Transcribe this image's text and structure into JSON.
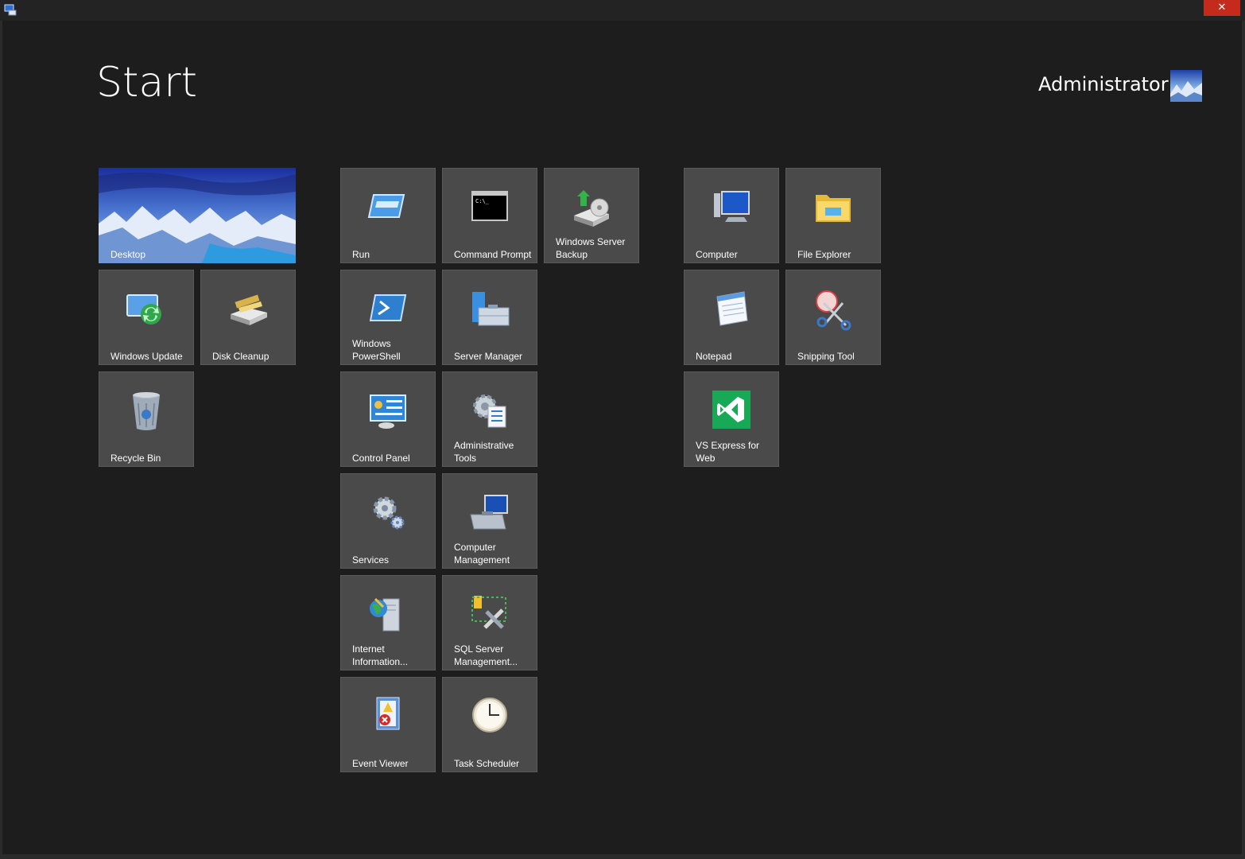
{
  "window": {
    "close_glyph": "✕"
  },
  "header": {
    "title": "Start",
    "user_name": "Administrator"
  },
  "groups": [
    {
      "tiles": [
        {
          "label": "Desktop",
          "icon": "desktop-wallpaper"
        },
        {
          "label": "Windows Update",
          "icon": "windows-update-icon"
        },
        {
          "label": "Disk Cleanup",
          "icon": "disk-cleanup-icon"
        },
        {
          "label": "Recycle Bin",
          "icon": "recycle-bin-icon"
        }
      ]
    },
    {
      "tiles": [
        {
          "label": "Run",
          "icon": "run-icon"
        },
        {
          "label": "Command Prompt",
          "icon": "command-prompt-icon"
        },
        {
          "label": "Windows Server Backup",
          "icon": "server-backup-icon"
        },
        {
          "label": "Windows PowerShell",
          "icon": "powershell-icon"
        },
        {
          "label": "Server Manager",
          "icon": "server-manager-icon"
        },
        {
          "label": "Control Panel",
          "icon": "control-panel-icon"
        },
        {
          "label": "Administrative Tools",
          "icon": "administrative-tools-icon"
        },
        {
          "label": "Services",
          "icon": "services-gear-icon"
        },
        {
          "label": "Computer Management",
          "icon": "computer-management-icon"
        },
        {
          "label": "Internet Information...",
          "icon": "iis-icon"
        },
        {
          "label": "SQL Server Management...",
          "icon": "sql-server-icon"
        },
        {
          "label": "Event Viewer",
          "icon": "event-viewer-icon"
        },
        {
          "label": "Task Scheduler",
          "icon": "task-scheduler-clock-icon"
        }
      ]
    },
    {
      "tiles": [
        {
          "label": "Computer",
          "icon": "computer-monitor-icon"
        },
        {
          "label": "File Explorer",
          "icon": "folder-icon"
        },
        {
          "label": "Notepad",
          "icon": "notepad-icon"
        },
        {
          "label": "Snipping Tool",
          "icon": "scissors-icon"
        },
        {
          "label": "VS Express for Web",
          "icon": "visual-studio-icon"
        }
      ]
    }
  ],
  "colors": {
    "background": "#1d1d1d",
    "tile": "#4a4a4a",
    "close": "#c42b1c",
    "vs_green": "#18a957"
  }
}
